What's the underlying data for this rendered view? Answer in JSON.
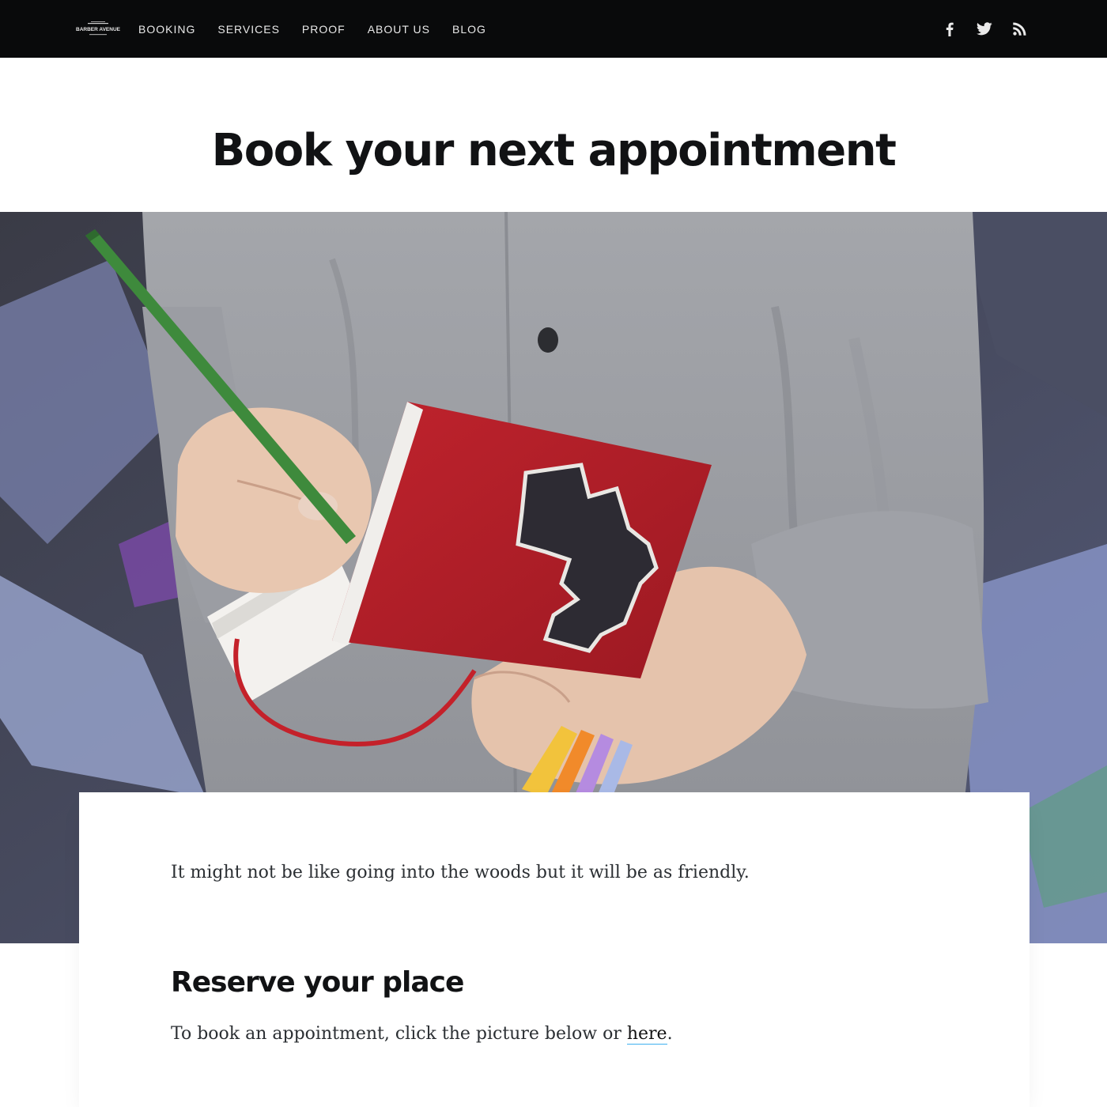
{
  "header": {
    "logo_text": "BARBER AVENUE",
    "nav": [
      {
        "label": "BOOKING"
      },
      {
        "label": "SERVICES"
      },
      {
        "label": "PROOF"
      },
      {
        "label": "ABOUT US"
      },
      {
        "label": "BLOG"
      }
    ],
    "social": [
      {
        "icon": "facebook-icon"
      },
      {
        "icon": "twitter-icon"
      },
      {
        "icon": "rss-icon"
      }
    ]
  },
  "page": {
    "title": "Book your next appointment"
  },
  "hero": {
    "description_icon": "hero-photo"
  },
  "content": {
    "intro": "It might not be like going into the woods but it will be as friendly.",
    "section_heading": "Reserve your place",
    "booking_prefix": "To book an appointment, click the picture below or ",
    "booking_link": "here",
    "booking_suffix": "."
  },
  "colors": {
    "header_bg": "#090a0b",
    "link_underline": "#3eb0ef",
    "notebook_red": "#b0202a"
  }
}
